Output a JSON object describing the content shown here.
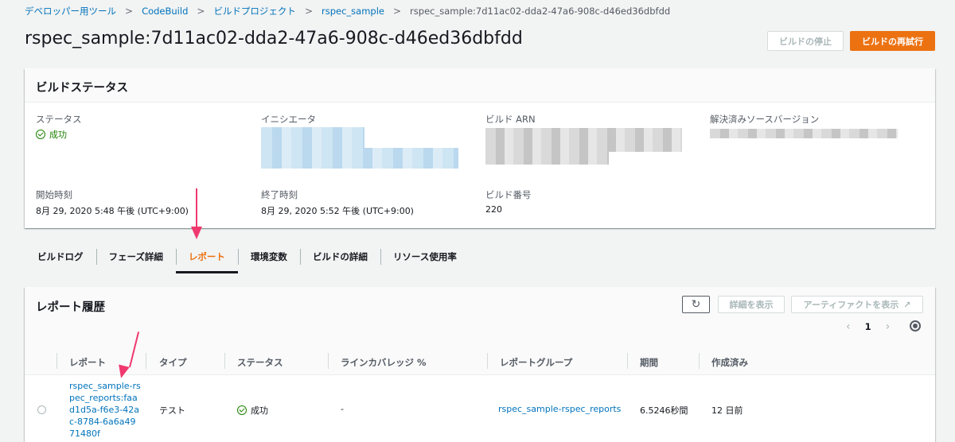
{
  "breadcrumb": {
    "items": [
      "デベロッパー用ツール",
      "CodeBuild",
      "ビルドプロジェクト",
      "rspec_sample"
    ],
    "current": "rspec_sample:7d11ac02-dda2-47a6-908c-d46ed36dbfdd"
  },
  "page": {
    "title": "rspec_sample:7d11ac02-dda2-47a6-908c-d46ed36dbfdd",
    "stop_button": "ビルドの停止",
    "retry_button": "ビルドの再試行"
  },
  "build_status": {
    "title": "ビルドステータス",
    "status_label": "ステータス",
    "status_value": "成功",
    "initiator_label": "イニシエータ",
    "arn_label": "ビルド ARN",
    "source_version_label": "解決済みソースバージョン",
    "start_label": "開始時刻",
    "start_value": "8月 29, 2020 5:48 午後 (UTC+9:00)",
    "end_label": "終了時刻",
    "end_value": "8月 29, 2020 5:52 午後 (UTC+9:00)",
    "build_number_label": "ビルド番号",
    "build_number_value": "220"
  },
  "tabs": [
    "ビルドログ",
    "フェーズ詳細",
    "レポート",
    "環境変数",
    "ビルドの詳細",
    "リソース使用率"
  ],
  "active_tab": "レポート",
  "reports": {
    "title": "レポート履歴",
    "detail_button": "詳細を表示",
    "artifact_button": "アーティファクトを表示",
    "page_number": "1",
    "columns": [
      "レポート",
      "タイプ",
      "ステータス",
      "ラインカバレッジ %",
      "レポートグループ",
      "期間",
      "作成済み"
    ],
    "rows": [
      {
        "report": "rspec_sample-rspec_reports:faad1d5a-f6e3-42ac-8784-6a6a4971480f",
        "type": "テスト",
        "status": "成功",
        "coverage": "-",
        "group": "rspec_sample-rspec_reports",
        "duration": "6.5246秒間",
        "created": "12 日前"
      }
    ]
  },
  "colors": {
    "accent_orange": "#ec7211",
    "link_blue": "#0073bb",
    "success_green": "#1d8102",
    "annotation_pink": "#f0396e"
  }
}
